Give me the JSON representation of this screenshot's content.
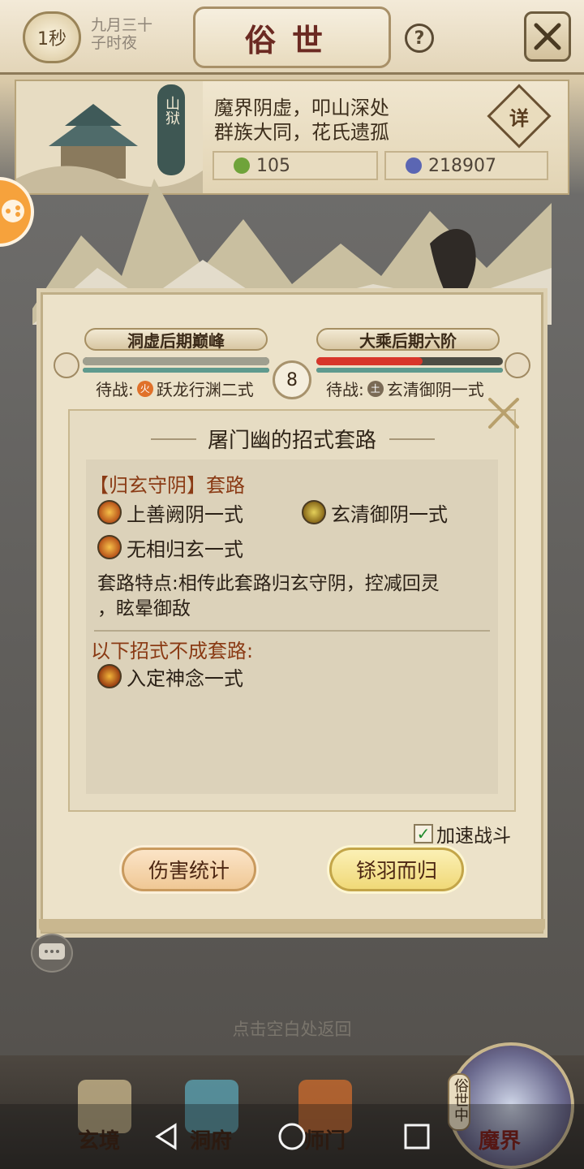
{
  "topbar": {
    "timer": "1秒",
    "date_line1": "九月三十",
    "date_line2": "子时夜",
    "title": "俗世",
    "help": "?"
  },
  "location": {
    "tag": "山狱",
    "desc_line1": "魔界阴虚，叩山深处",
    "desc_line2": "群族大同，花氏遗孤",
    "detail_label": "详",
    "res1_value": "105",
    "res2_value": "218907"
  },
  "battle": {
    "left_rank": "洞虚后期巅峰",
    "right_rank": "大乘后期六阶",
    "round": "8",
    "left_standby_prefix": "待战:",
    "left_standby_element": "火",
    "left_standby_skill": "跃龙行渊二式",
    "right_standby_prefix": "待战:",
    "right_standby_element": "土",
    "right_standby_skill": "玄清御阴一式",
    "left_hp": 1.0,
    "right_hp": 0.57
  },
  "dialog": {
    "title": "屠门幽的招式套路",
    "set_heading": "【归玄守阴】套路",
    "skills": [
      "上善阙阴一式",
      "玄清御阴一式",
      "无相归玄一式"
    ],
    "feature_line1": "套路特点:相传此套路归玄守阴，控减回灵",
    "feature_line2": "，眩晕御敌",
    "nonset_heading": "以下招式不成套路:",
    "nonset_skills": [
      "入定神念一式"
    ],
    "speed_label": "加速战斗",
    "speed_checked": true,
    "damage_button": "伤害统计",
    "return_button": "铩羽而归"
  },
  "hint": "点击空白处返回",
  "nav": {
    "items": [
      "玄境",
      "洞府",
      "师门",
      "魔界"
    ],
    "mojie_badge": "俗世中"
  },
  "colors": {
    "accent_red": "#d8362a",
    "hp_green": "#5f9a8e",
    "set_title": "#8a3a14"
  }
}
